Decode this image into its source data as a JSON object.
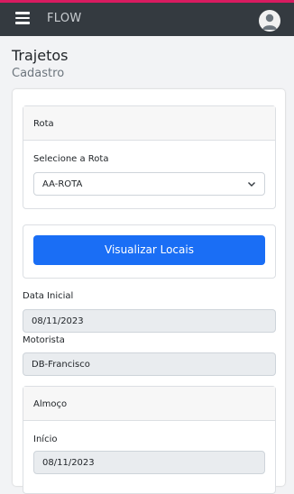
{
  "app": {
    "brand": "FLOW"
  },
  "icons": {
    "menu": "hamburger-icon",
    "user": "user-avatar-icon",
    "select": "chevron-down-icon"
  },
  "colors": {
    "navbar": "#343a40",
    "accent_strip": "#d81b60",
    "primary": "#1a6ef5"
  },
  "page": {
    "title": "Trajetos",
    "subtitle": "Cadastro"
  },
  "rota_card": {
    "header": "Rota",
    "select_label": "Selecione a Rota",
    "select_value": "AA-ROTA"
  },
  "locais_button": "Visualizar Locais",
  "fields": {
    "data_inicial_label": "Data Inicial",
    "data_inicial_value": "08/11/2023",
    "motorista_label": "Motorista",
    "motorista_value": "DB-Francisco"
  },
  "almoco_card": {
    "header": "Almoço",
    "inicio_label": "Início",
    "inicio_value": "08/11/2023"
  }
}
